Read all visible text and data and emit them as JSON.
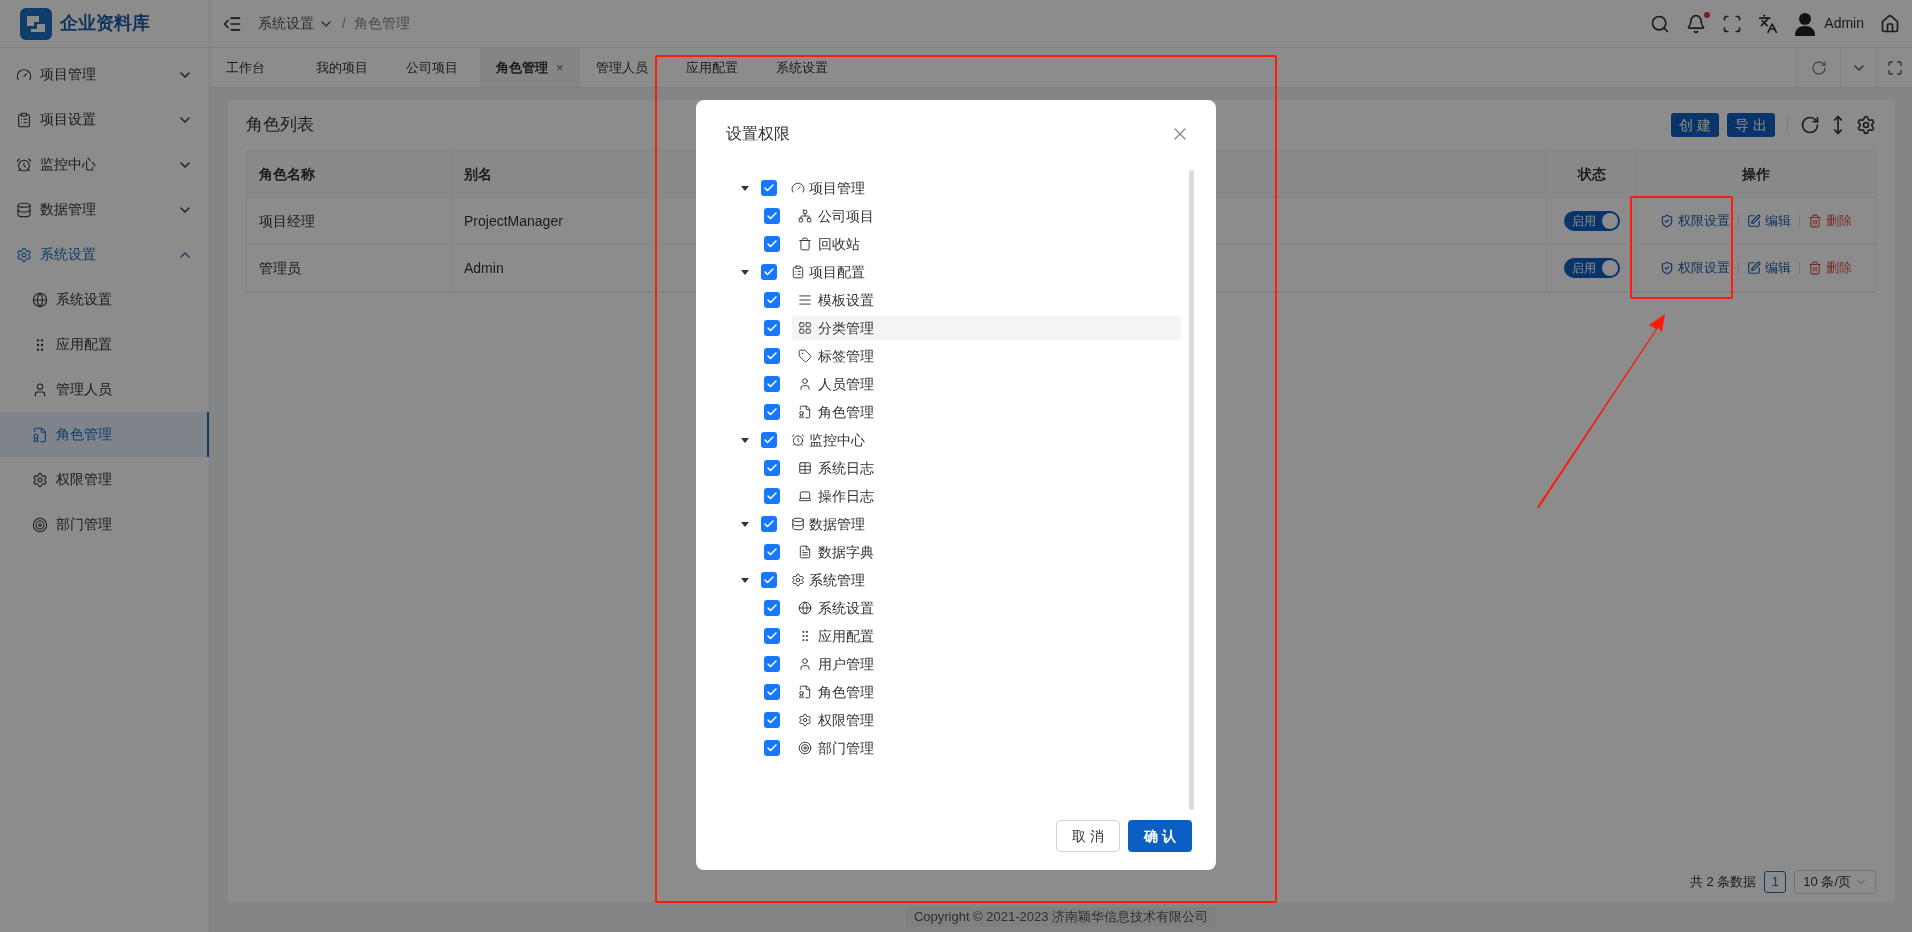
{
  "app": {
    "title": "企业资料库",
    "breadcrumb": [
      {
        "label": "系统设置",
        "dropdown": true
      },
      {
        "label": "角色管理",
        "dropdown": false
      }
    ],
    "separator": "/",
    "user": "Admin",
    "notification_dot": true
  },
  "sidebar": {
    "items": [
      {
        "label": "项目管理",
        "expanded": false,
        "selected": false
      },
      {
        "label": "项目设置",
        "expanded": false,
        "selected": false
      },
      {
        "label": "监控中心",
        "expanded": false,
        "selected": false
      },
      {
        "label": "数据管理",
        "expanded": false,
        "selected": false
      },
      {
        "label": "系统设置",
        "expanded": true,
        "selected": true,
        "children": [
          {
            "label": "系统设置",
            "selected": false
          },
          {
            "label": "应用配置",
            "selected": false
          },
          {
            "label": "管理人员",
            "selected": false
          },
          {
            "label": "角色管理",
            "selected": true
          },
          {
            "label": "权限管理",
            "selected": false
          },
          {
            "label": "部门管理",
            "selected": false
          }
        ]
      }
    ]
  },
  "tabs": [
    {
      "label": "工作台",
      "selected": false
    },
    {
      "label": "我的项目",
      "selected": false
    },
    {
      "label": "公司项目",
      "selected": false
    },
    {
      "label": "角色管理",
      "selected": true,
      "close": "×"
    },
    {
      "label": "管理人员",
      "selected": false
    },
    {
      "label": "应用配置",
      "selected": false
    },
    {
      "label": "系统设置",
      "selected": false
    }
  ],
  "card": {
    "title": "角色列表",
    "buttons": [
      "创 建",
      "导 出"
    ]
  },
  "table": {
    "columns": [
      "角色名称",
      "别名",
      "状态",
      "操作"
    ],
    "rows": [
      {
        "name": "项目经理",
        "alias": "ProjectManager",
        "status": {
          "label": "启用",
          "on": true
        },
        "actions": [
          {
            "kind": "permission",
            "label": "权限设置"
          },
          {
            "kind": "edit",
            "label": "编辑"
          },
          {
            "kind": "delete",
            "label": "删除"
          }
        ]
      },
      {
        "name": "管理员",
        "alias": "Admin",
        "status": {
          "label": "启用",
          "on": true
        },
        "actions": [
          {
            "kind": "permission",
            "label": "权限设置"
          },
          {
            "kind": "edit",
            "label": "编辑"
          },
          {
            "kind": "delete",
            "label": "删除"
          }
        ]
      }
    ]
  },
  "pagination": {
    "total": "共 2 条数据",
    "pages": [
      {
        "label": "1",
        "selected": true
      }
    ],
    "page_size": "10 条/页"
  },
  "footer": "Copyright © 2021-2023 济南颖华信息技术有限公司",
  "dialog": {
    "title": "设置权限",
    "buttons": [
      {
        "kind": "cancel",
        "label": "取 消"
      },
      {
        "kind": "confirm",
        "label": "确 认"
      }
    ],
    "tree": [
      {
        "label": "项目管理",
        "checked": true,
        "expanded": true,
        "selected": false,
        "children": [
          {
            "label": "公司项目",
            "checked": true,
            "selected": false
          },
          {
            "label": "回收站",
            "checked": true,
            "selected": false
          }
        ]
      },
      {
        "label": "项目配置",
        "checked": true,
        "expanded": true,
        "selected": false,
        "children": [
          {
            "label": "模板设置",
            "checked": true,
            "selected": false
          },
          {
            "label": "分类管理",
            "checked": true,
            "selected": true
          },
          {
            "label": "标签管理",
            "checked": true,
            "selected": false
          },
          {
            "label": "人员管理",
            "checked": true,
            "selected": false
          },
          {
            "label": "角色管理",
            "checked": true,
            "selected": false
          }
        ]
      },
      {
        "label": "监控中心",
        "checked": true,
        "expanded": true,
        "selected": false,
        "children": [
          {
            "label": "系统日志",
            "checked": true,
            "selected": false
          },
          {
            "label": "操作日志",
            "checked": true,
            "selected": false
          }
        ]
      },
      {
        "label": "数据管理",
        "checked": true,
        "expanded": true,
        "selected": false,
        "children": [
          {
            "label": "数据字典",
            "checked": true,
            "selected": false
          }
        ]
      },
      {
        "label": "系统管理",
        "checked": true,
        "expanded": true,
        "selected": false,
        "children": [
          {
            "label": "系统设置",
            "checked": true,
            "selected": false
          },
          {
            "label": "应用配置",
            "checked": true,
            "selected": false
          },
          {
            "label": "用户管理",
            "checked": true,
            "selected": false
          },
          {
            "label": "角色管理",
            "checked": true,
            "selected": false
          },
          {
            "label": "权限管理",
            "checked": true,
            "selected": false
          },
          {
            "label": "部门管理",
            "checked": true,
            "selected": false
          }
        ]
      }
    ]
  }
}
